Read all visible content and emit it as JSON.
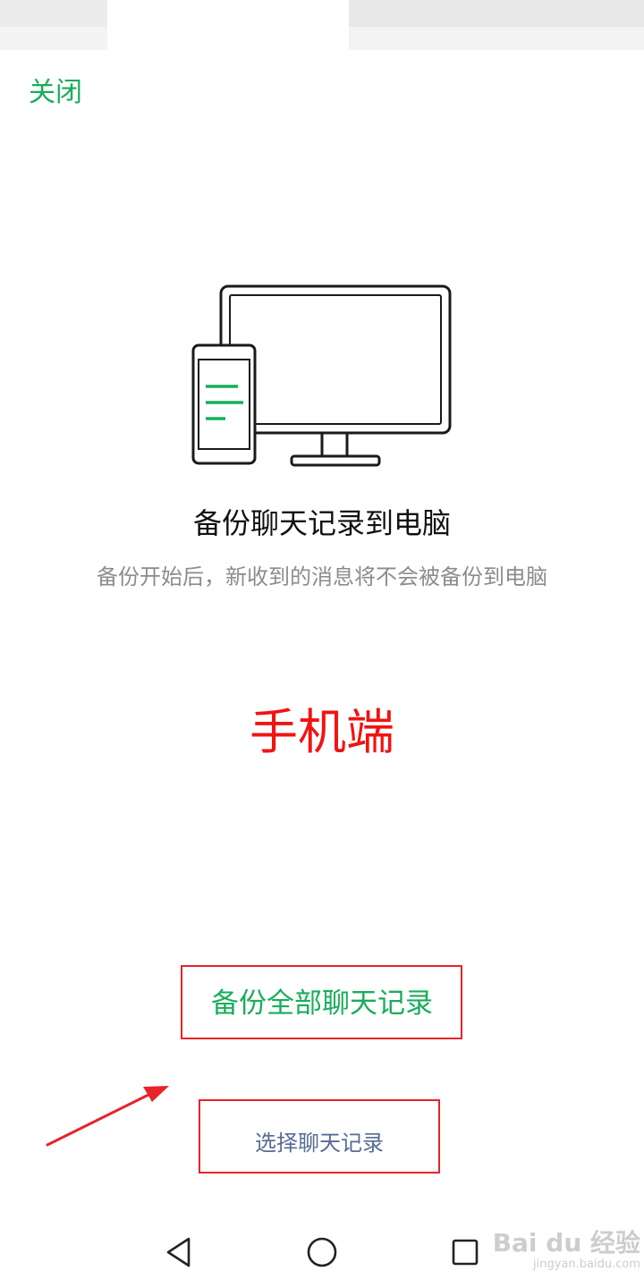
{
  "header": {
    "close_label": "关闭"
  },
  "content": {
    "title": "备份聊天记录到电脑",
    "subtitle": "备份开始后，新收到的消息将不会被备份到电脑",
    "annotation": "手机端"
  },
  "actions": {
    "backup_all_label": "备份全部聊天记录",
    "select_label": "选择聊天记录"
  },
  "navigation": {
    "items": [
      "back-icon",
      "home-icon",
      "recents-icon"
    ]
  },
  "watermark": {
    "brand": "Bai du 经验",
    "url": "jingyan.baidu.com"
  },
  "colors": {
    "accent": "#1aad5a",
    "annotation": "#f01414",
    "link": "#576b95"
  }
}
